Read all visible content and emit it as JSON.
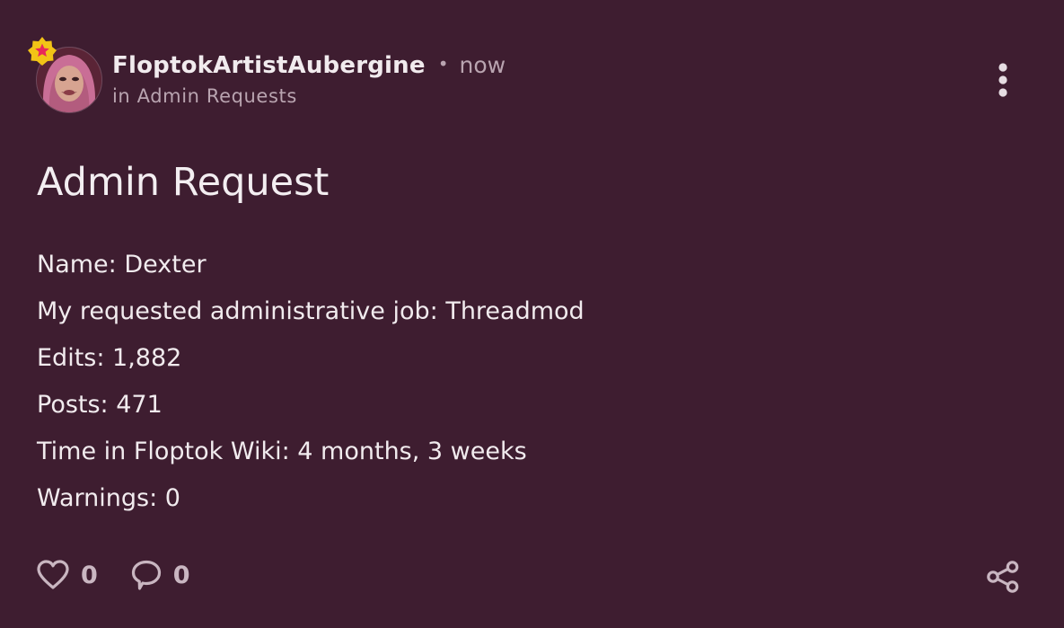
{
  "colors": {
    "background": "#3e1d30",
    "text_primary": "#f3eef1",
    "text_muted": "#b9a4b0",
    "badge_gold": "#f2c416",
    "badge_star": "#e8285a"
  },
  "post": {
    "author": {
      "name": "FloptokArtistAubergine",
      "avatar_icon": "user-avatar",
      "badge_icon": "star-badge-icon"
    },
    "timestamp": "now",
    "board_label": "in Admin Requests",
    "more_icon": "more-vertical-icon",
    "title": "Admin Request",
    "body_lines": [
      "Name: Dexter",
      "My requested administrative job: Threadmod",
      "Edits: 1,882",
      "Posts: 471",
      "Time in Floptok Wiki: 4 months, 3 weeks",
      "Warnings: 0"
    ],
    "likes": {
      "icon": "heart-icon",
      "count": "0"
    },
    "comments": {
      "icon": "comment-icon",
      "count": "0"
    },
    "share_icon": "share-icon"
  }
}
